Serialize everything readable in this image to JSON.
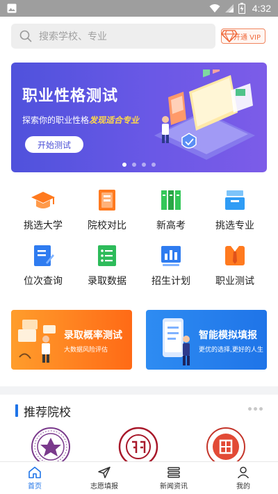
{
  "status_bar": {
    "time": "4:32"
  },
  "search": {
    "placeholder": "搜索学校、专业"
  },
  "vip_button": {
    "label": "开通 VIP"
  },
  "banner": {
    "title": "职业性格测试",
    "subtitle_prefix": "探索你的职业性格",
    "subtitle_highlight": "发现适合专业",
    "button_label": "开始测试",
    "pagination": {
      "count": 4,
      "active_index": 0
    }
  },
  "grid": {
    "items": [
      {
        "label": "挑选大学",
        "icon": "graduation-cap-icon",
        "color": "#ff7a1f"
      },
      {
        "label": "院校对比",
        "icon": "compare-doc-icon",
        "color": "#ff7a1f"
      },
      {
        "label": "新高考",
        "icon": "books-icon",
        "color": "#34c759"
      },
      {
        "label": "挑选专业",
        "icon": "inbox-tray-icon",
        "color": "#2f9cf5"
      },
      {
        "label": "位次查询",
        "icon": "edit-doc-icon",
        "color": "#2f7cf0"
      },
      {
        "label": "录取数据",
        "icon": "list-doc-icon",
        "color": "#2dbb5a"
      },
      {
        "label": "招生计划",
        "icon": "bar-chart-icon",
        "color": "#2f7cf0"
      },
      {
        "label": "职业测试",
        "icon": "suit-tie-icon",
        "color": "#ff7a1f"
      }
    ]
  },
  "promos": [
    {
      "title": "录取概率测试",
      "subtitle": "大数据风险评估"
    },
    {
      "title": "智能模拟填报",
      "subtitle": "更优的选择,更好的人生"
    }
  ],
  "recommended": {
    "title": "推荐院校",
    "logos": [
      "tsinghua-seal-icon",
      "peking-university-seal-icon",
      "fudan-university-seal-icon"
    ]
  },
  "bottom_nav": {
    "items": [
      {
        "label": "首页",
        "icon": "home-icon",
        "active": true
      },
      {
        "label": "志愿填报",
        "icon": "send-icon",
        "active": false
      },
      {
        "label": "新闻资讯",
        "icon": "news-icon",
        "active": false
      },
      {
        "label": "我的",
        "icon": "profile-icon",
        "active": false
      }
    ]
  },
  "colors": {
    "accent": "#1f74e8",
    "banner": "#5a55e0",
    "orange": "#ff7a1f"
  }
}
